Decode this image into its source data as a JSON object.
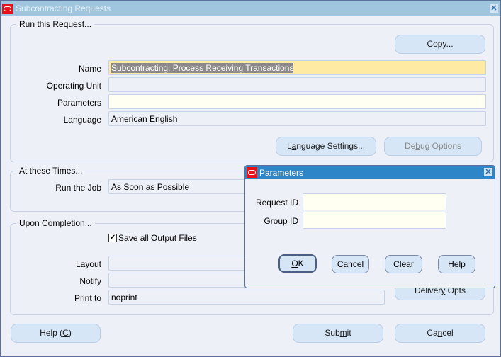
{
  "window": {
    "title": "Subcontracting Requests",
    "close_icon": "close-icon",
    "logo_icon": "oracle-logo-icon"
  },
  "run_request": {
    "group_label": "Run this Request...",
    "copy_label": "Copy...",
    "name_label": "Name",
    "name_value": "Subcontracting: Process Receiving Transactions",
    "operating_unit_label": "Operating Unit",
    "operating_unit_value": "",
    "parameters_label": "Parameters",
    "parameters_value": "",
    "language_label": "Language",
    "language_value": "American English",
    "language_settings_pre": "L",
    "language_settings_ul": "a",
    "language_settings_post": "nguage Settings...",
    "debug_pre": "De",
    "debug_ul": "b",
    "debug_post": "ug Options"
  },
  "times": {
    "group_label": "At these Times...",
    "run_job_label": "Run the Job",
    "run_job_value": "As Soon as Possible"
  },
  "completion": {
    "group_label": "Upon Completion...",
    "save_output_checked": true,
    "save_output_ul": "S",
    "save_output_post": "ave all Output Files",
    "layout_label": "Layout",
    "layout_value": "",
    "notify_label": "Notify",
    "notify_value": "",
    "print_to_label": "Print to",
    "print_to_value": "noprint",
    "delivery_pre": "Deliver",
    "delivery_ul": "y",
    "delivery_post": " Opts"
  },
  "footer": {
    "help_pre": "Help (",
    "help_ul": "C",
    "help_post": ")",
    "submit_pre": "Sub",
    "submit_ul": "m",
    "submit_post": "it",
    "cancel_pre": "Ca",
    "cancel_ul": "n",
    "cancel_post": "cel"
  },
  "parameters_dialog": {
    "title": "Parameters",
    "request_id_label": "Request ID",
    "request_id_value": "",
    "group_id_label": "Group ID",
    "group_id_value": "",
    "ok_ul": "O",
    "ok_post": "K",
    "cancel_ul": "C",
    "cancel_post": "ancel",
    "clear_pre": "C",
    "clear_ul": "l",
    "clear_post": "ear",
    "help_ul": "H",
    "help_post": "elp"
  }
}
